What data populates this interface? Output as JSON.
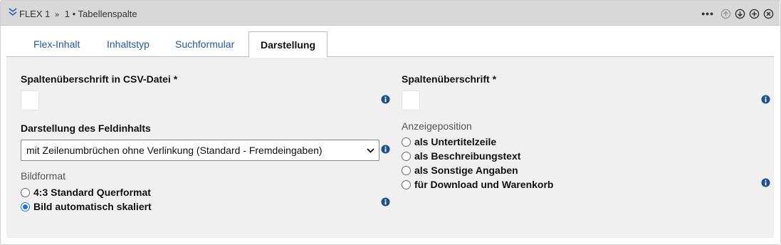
{
  "header": {
    "title": "FLEX 1",
    "separator": "»",
    "subtitle": "1 • Tabellenspalte",
    "more_label": "•••"
  },
  "tabs": [
    {
      "label": "Flex-Inhalt",
      "active": false
    },
    {
      "label": "Inhaltstyp",
      "active": false
    },
    {
      "label": "Suchformular",
      "active": false
    },
    {
      "label": "Darstellung",
      "active": true
    }
  ],
  "left": {
    "csv_heading_label": "Spaltenüberschrift in CSV-Datei *",
    "csv_heading_value": "",
    "display_label": "Darstellung des Feldinhalts",
    "display_select_value": "mit Zeilenumbrüchen ohne Verlinkung (Standard - Fremdeingaben)",
    "image_format_label": "Bildformat",
    "image_format_options": [
      {
        "label": "4:3 Standard Querformat",
        "checked": false
      },
      {
        "label": "Bild automatisch skaliert",
        "checked": true
      }
    ]
  },
  "right": {
    "heading_label": "Spaltenüberschrift *",
    "heading_value": "",
    "position_label": "Anzeigeposition",
    "position_options": [
      {
        "label": "als Untertitelzeile",
        "checked": false
      },
      {
        "label": "als Beschreibungstext",
        "checked": false
      },
      {
        "label": "als Sonstige Angaben",
        "checked": false
      },
      {
        "label": "für Download und Warenkorb",
        "checked": false
      }
    ]
  },
  "colors": {
    "accent": "#1a73e8",
    "tab_link": "#1f5aa6",
    "info_icon": "#1f4f8f",
    "header_bg": "#d8d8d8",
    "panel_bg": "#f0f0f0"
  }
}
